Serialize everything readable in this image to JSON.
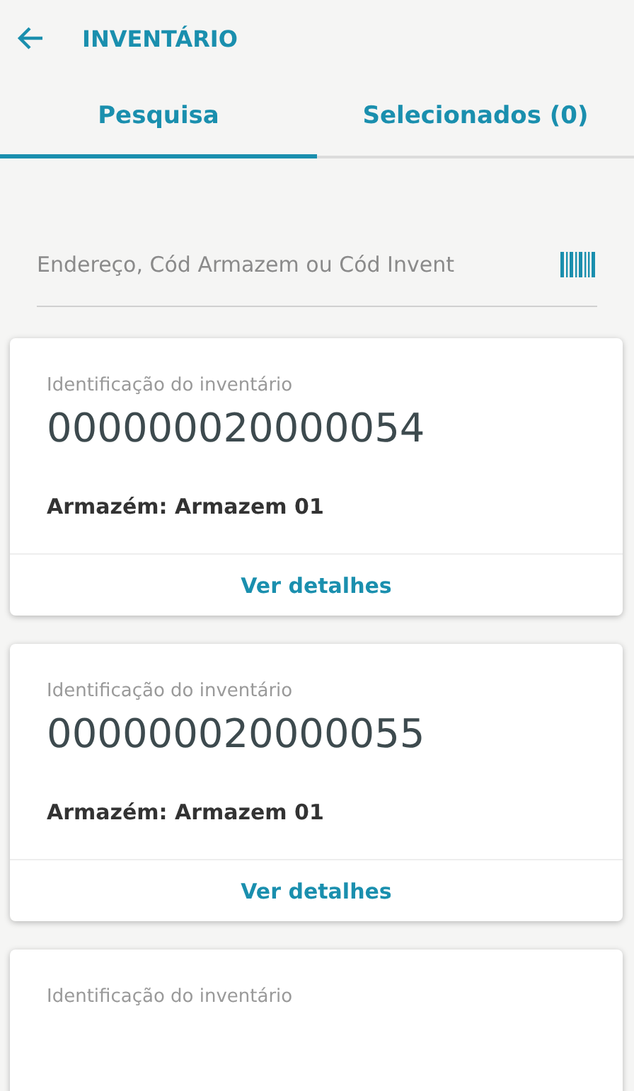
{
  "header": {
    "title": "INVENTÁRIO"
  },
  "tabs": [
    {
      "label": "Pesquisa",
      "selected": true
    },
    {
      "label": "Selecionados (0)",
      "selected": false
    }
  ],
  "search": {
    "placeholder": "Endereço, Cód Armazem ou Cód Invent"
  },
  "cards": [
    {
      "label": "Identificação do inventário",
      "id": "000000020000054",
      "warehouse": "Armazém: Armazem 01",
      "action": "Ver detalhes"
    },
    {
      "label": "Identificação do inventário",
      "id": "000000020000055",
      "warehouse": "Armazém: Armazem 01",
      "action": "Ver detalhes"
    },
    {
      "label": "Identificação do inventário"
    }
  ]
}
